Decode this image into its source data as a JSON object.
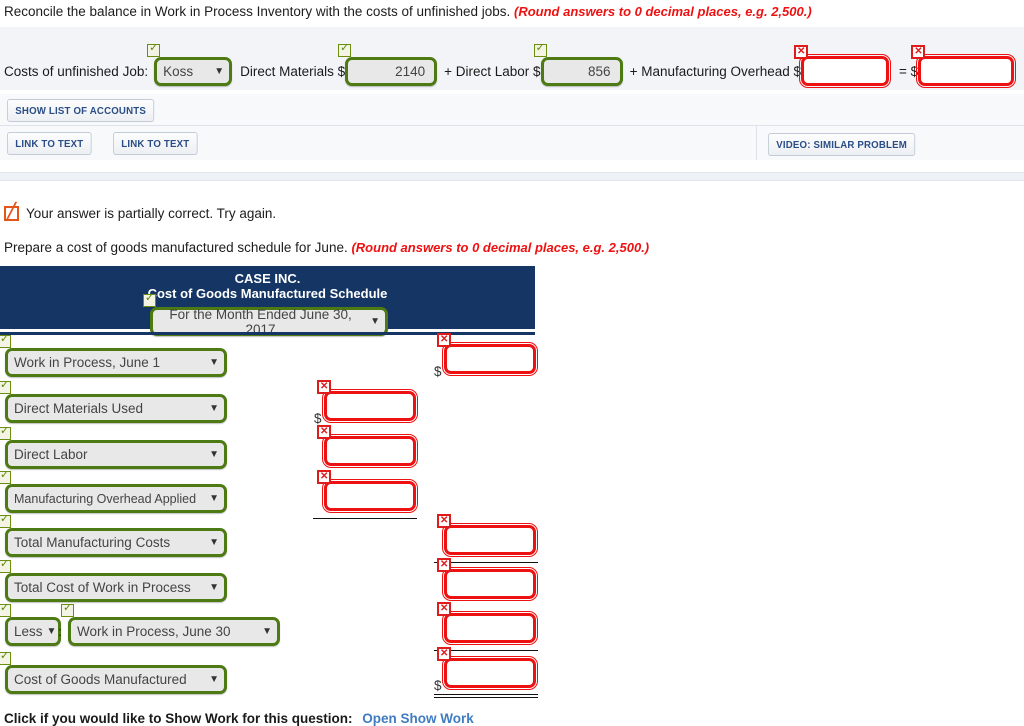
{
  "prompt_1": {
    "text": "Reconcile the balance in Work in Process Inventory with the costs of unfinished jobs. ",
    "note": "(Round answers to 0 decimal places, e.g. 2,500.)"
  },
  "reconcile": {
    "label_job": "Costs of unfinished Job:",
    "job_value": "Koss",
    "label_dm": "Direct Materials $",
    "dm_value": "2140",
    "label_dl": "+ Direct Labor $",
    "dl_value": "856",
    "label_moh": "+ Manufacturing Overhead $",
    "moh_value": "",
    "label_eq": "= $",
    "total_value": "",
    "caret": "▼"
  },
  "toolbar": {
    "show_list_of_accounts": "SHOW LIST OF ACCOUNTS",
    "link_to_text_1": "LINK TO TEXT",
    "link_to_text_2": "LINK TO TEXT",
    "video_similar_problem": "VIDEO: SIMILAR PROBLEM"
  },
  "status": {
    "message": "Your answer is partially correct.  Try again."
  },
  "prompt_2": {
    "text": "Prepare a cost of goods manufactured schedule for June. ",
    "note": "(Round answers to 0 decimal places, e.g. 2,500.)"
  },
  "schedule": {
    "company": "CASE INC.",
    "title": "Cost of Goods Manufactured Schedule",
    "period": "For the Month Ended June 30, 2017",
    "caret": "▼",
    "dollar": "$",
    "colon": ":",
    "rows": [
      {
        "label": "Work in Process, June 1",
        "value": "",
        "column": "right",
        "dollar": true
      },
      {
        "label": "Direct Materials Used",
        "value": "",
        "column": "mid",
        "dollar": true
      },
      {
        "label": "Direct Labor",
        "value": "",
        "column": "mid",
        "dollar": false
      },
      {
        "label": "Manufacturing Overhead Applied",
        "value": "",
        "column": "mid",
        "dollar": false
      },
      {
        "label": "Total Manufacturing Costs",
        "value": "",
        "column": "right",
        "dollar": false
      },
      {
        "label": "Total Cost of Work in Process",
        "value": "",
        "column": "right",
        "dollar": false
      },
      {
        "label": "Work in Process, June 30",
        "value": "",
        "column": "right",
        "dollar": false,
        "prefix": "Less"
      },
      {
        "label": "Cost of Goods Manufactured",
        "value": "",
        "column": "right",
        "dollar": true
      }
    ],
    "prefix_less": "Less"
  },
  "footer": {
    "text": "Click if you would like to Show Work for this question:",
    "link": "Open Show Work"
  },
  "colors": {
    "header_navy": "#153564",
    "correct_green": "#4d7a12",
    "error_red": "#ee1111",
    "note_red": "#ee1111",
    "button_blue": "#2a4d86",
    "partial_orange": "#e2551b"
  }
}
